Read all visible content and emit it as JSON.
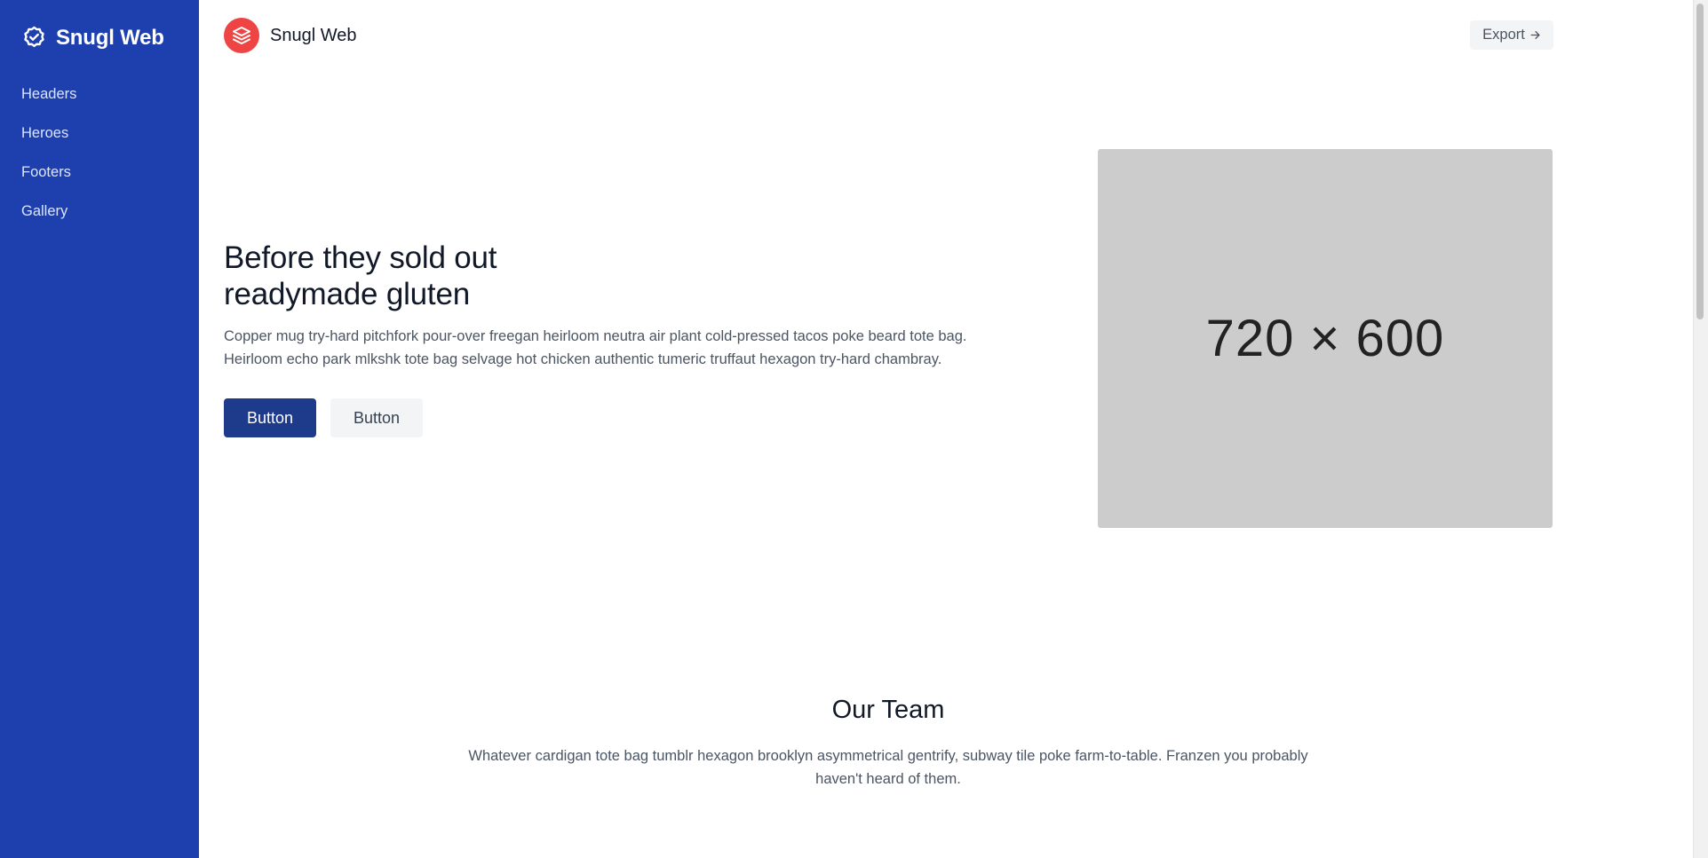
{
  "sidebar": {
    "brand": "Snugl Web",
    "items": [
      {
        "label": "Headers"
      },
      {
        "label": "Heroes"
      },
      {
        "label": "Footers"
      },
      {
        "label": "Gallery"
      }
    ]
  },
  "header": {
    "logo_text": "Snugl Web",
    "export_label": "Export",
    "export_icon": "arrow-right-icon"
  },
  "hero": {
    "title_line1": "Before they sold out",
    "title_line2": "readymade gluten",
    "text_line1": "Copper mug try-hard pitchfork pour-over freegan heirloom neutra air plant cold-pressed tacos poke beard tote bag.",
    "text_line2": "Heirloom echo park mlkshk tote bag selvage hot chicken authentic tumeric truffaut hexagon try-hard chambray.",
    "primary_button": "Button",
    "secondary_button": "Button",
    "image_placeholder": "720 × 600"
  },
  "team": {
    "title": "Our Team",
    "text_line1": "Whatever cardigan tote bag tumblr hexagon brooklyn asymmetrical gentrify, subway tile poke farm-to-table. Franzen you probably",
    "text_line2": "haven't heard of them."
  },
  "colors": {
    "sidebar_bg": "#1e40af",
    "primary_button": "#1e3a8a",
    "logo_accent": "#ef4444",
    "placeholder_bg": "#cccccc"
  }
}
